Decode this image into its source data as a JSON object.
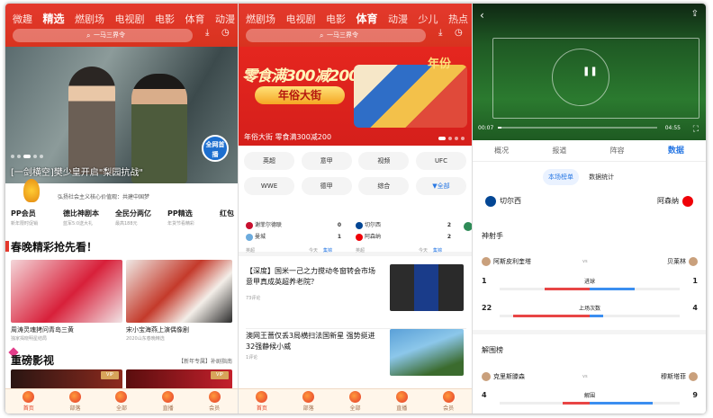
{
  "p1": {
    "channels": [
      "微趣",
      "精选",
      "燃剧场",
      "电视剧",
      "电影",
      "体育",
      "动漫"
    ],
    "active_channel": "精选",
    "search_placeholder": "一马三界令",
    "hero_caption": "[一剑横空]樊少皇开启\"梨园抗战\"",
    "hero_badge": "全网首播",
    "slogan": "弘扬社会主义核心价值观：共建中国梦",
    "pp_items": [
      {
        "title": "PP会员",
        "sub": "新年限时促销"
      },
      {
        "title": "德比神剧本",
        "sub": "蓝军5:0送大礼"
      },
      {
        "title": "全民分两亿",
        "sub": "最高188元"
      },
      {
        "title": "PP精选",
        "sub": "年货节看精彩"
      },
      {
        "title": "红包",
        "sub": ""
      }
    ],
    "section1": "春晚精彩抢先看！",
    "thumb_a": {
      "title": "周涛灵魂拷问青岛三黄",
      "sub": "独家揭晓明星结局"
    },
    "thumb_b": {
      "title": "宋小宝海燕上演偶像剧",
      "sub": "2020山东春晚精选"
    },
    "section2": "重磅影视",
    "more": "【新年专属】补剧指南",
    "vip": "VIP",
    "bottom": [
      "首页",
      "部落",
      "全部",
      "直播",
      "会员"
    ]
  },
  "p2": {
    "channels": [
      "燃剧场",
      "电视剧",
      "电影",
      "体育",
      "动漫",
      "少儿",
      "热点"
    ],
    "active_channel": "体育",
    "search_placeholder": "一马三界令",
    "banner_big": "零食满300减200",
    "banner_pill": "年俗大街",
    "banner_year": "年份",
    "banner_caption": "年俗大街 零食满300减200",
    "tags_row1": [
      "英超",
      "意甲",
      "视频",
      "UFC"
    ],
    "tags_row2": [
      "WWE",
      "德甲",
      "综合",
      "▼全部"
    ],
    "match1": {
      "home": "谢菲尔德联",
      "away": "曼城",
      "home_score": "0",
      "away_score": "1",
      "league": "英超",
      "day": "今天",
      "status": "集锦"
    },
    "match2": {
      "home": "切尔西",
      "away": "阿森纳",
      "home_score": "2",
      "away_score": "2",
      "league": "英超",
      "day": "今天",
      "status": "集锦"
    },
    "news1": {
      "title": "【深度】国米一己之力搅动冬窗转会市场 意甲真成英超养老院？",
      "comments": "73评论"
    },
    "news2": {
      "title": "澳网王蔷仅丢3局横扫法国新星 强势挺进32强静候小威",
      "comments": "1评论"
    },
    "bottom": [
      "首页",
      "部落",
      "全部",
      "直播",
      "会员"
    ]
  },
  "p3": {
    "time_played": "00:07",
    "time_total": "04:55",
    "progress": 0.02,
    "tabs": [
      "概况",
      "报道",
      "阵容",
      "数据"
    ],
    "active_tab": "数据",
    "seg": [
      "本场榜单",
      "数据统计"
    ],
    "home_team": "切尔西",
    "away_team": "阿森纳",
    "shooter_title": "神射手",
    "shooter_home": "阿斯皮利奎塔",
    "shooter_away": "贝莱林",
    "vs": "vs",
    "stats": [
      {
        "name": "进球",
        "home": "1",
        "away": "1",
        "home_frac": 0.5,
        "away_frac": 0.5
      },
      {
        "name": "上场次数",
        "home": "22",
        "away": "4",
        "home_frac": 0.85,
        "away_frac": 0.15
      }
    ],
    "clear_title": "解围榜",
    "clear_home": "克里斯滕森",
    "clear_away": "穆斯塔菲",
    "clear_stat": {
      "name": "解围",
      "home": "4",
      "away": "9",
      "home_frac": 0.3,
      "away_frac": 0.7
    }
  }
}
